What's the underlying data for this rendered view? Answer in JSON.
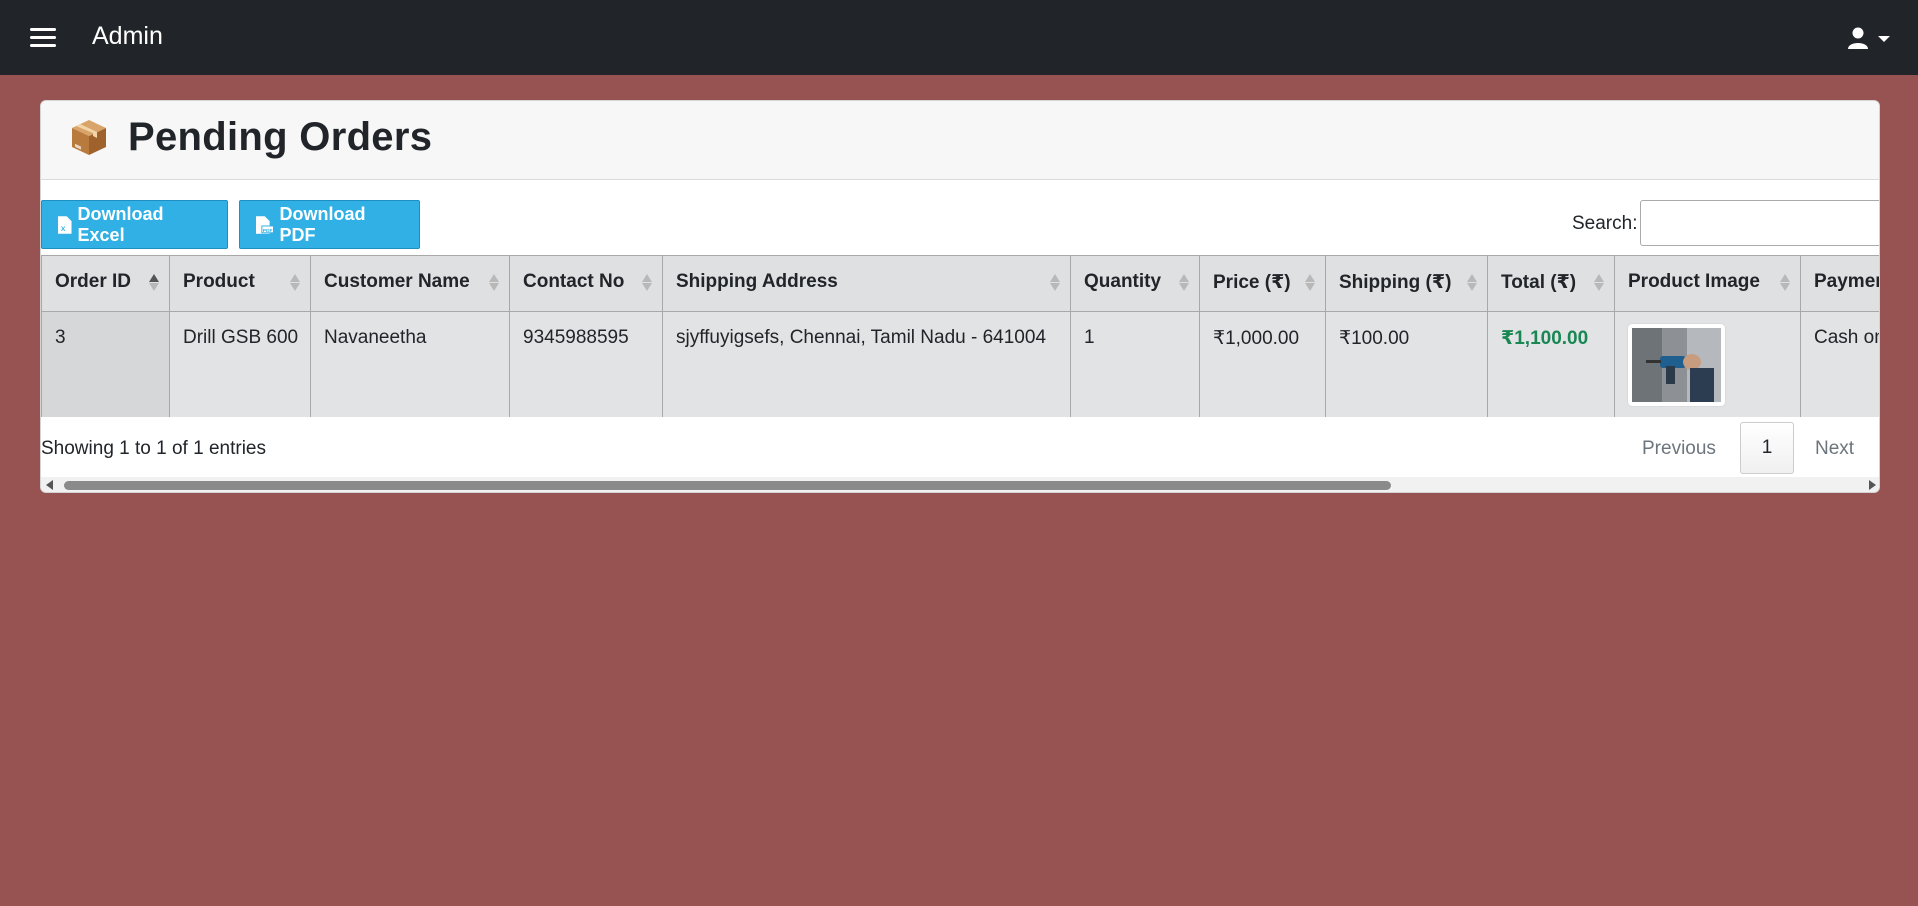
{
  "navbar": {
    "brand": "Admin",
    "menu_icon": "hamburger-menu-icon",
    "user_icon": "user-icon"
  },
  "page": {
    "title": "Pending Orders",
    "title_icon": "package-box-icon"
  },
  "toolbar": {
    "excel_label": "Download Excel",
    "pdf_label": "Download PDF",
    "search_label": "Search:",
    "search_value": ""
  },
  "table": {
    "headers": [
      "Order ID",
      "Product",
      "Customer Name",
      "Contact No",
      "Shipping Address",
      "Quantity",
      "Price (₹)",
      "Shipping (₹)",
      "Total (₹)",
      "Product Image",
      "Payment"
    ],
    "rows": [
      {
        "order_id": "3",
        "product": "Drill GSB 600",
        "customer": "Navaneetha",
        "contact": "9345988595",
        "address": "sjyffuyigsefs, Chennai, Tamil Nadu - 641004",
        "quantity": "1",
        "price": "₹1,000.00",
        "shipping": "₹100.00",
        "total": "₹1,100.00",
        "payment": "Cash on Delivery"
      }
    ],
    "sorted_column": "Order ID",
    "total_color": "#198754"
  },
  "footer": {
    "info": "Showing 1 to 1 of 1 entries",
    "prev": "Previous",
    "page": "1",
    "next": "Next"
  },
  "colors": {
    "background": "#975252",
    "navbar": "#212529",
    "button": "#31b0e6"
  }
}
